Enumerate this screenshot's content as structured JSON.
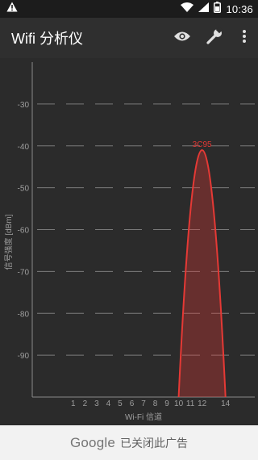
{
  "status_bar": {
    "time": "10:36",
    "icons": [
      "warning-icon",
      "wifi-icon",
      "signal-icon",
      "battery-icon"
    ]
  },
  "app_bar": {
    "title": "Wifi 分析仪",
    "actions": [
      "eye-icon",
      "wrench-icon",
      "more-vert-icon"
    ]
  },
  "chart_data": {
    "type": "area",
    "ylabel": "信号强度 [dBm]",
    "xlabel": "Wi-Fi 信道",
    "ylim": [
      -100,
      -20
    ],
    "yticks": [
      -30,
      -40,
      -50,
      -60,
      -70,
      -80,
      -90
    ],
    "xticks": [
      1,
      2,
      3,
      4,
      5,
      6,
      7,
      8,
      9,
      10,
      11,
      12,
      14
    ],
    "xlim": [
      -2.5,
      16.5
    ],
    "grid": true,
    "series": [
      {
        "name": "3C95",
        "channel": 12,
        "channel_width": [
          10,
          14
        ],
        "peak": -41,
        "color": "#e53935"
      }
    ]
  },
  "ad_bar": {
    "brand": "Google",
    "text": "已关闭此广告"
  }
}
